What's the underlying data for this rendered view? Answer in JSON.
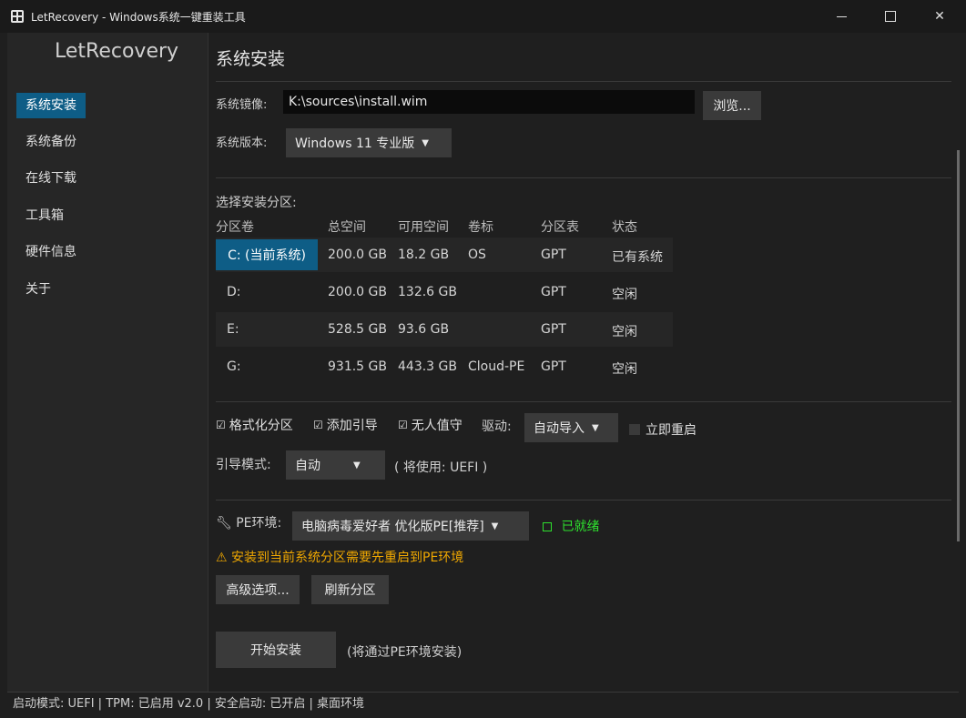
{
  "window": {
    "title": "LetRecovery - Windows系统一键重装工具",
    "minimize": "—",
    "maximize": "☐",
    "close": "✕"
  },
  "sidebar": {
    "brand": "LetRecovery",
    "items": [
      {
        "label": "系统安装",
        "active": true
      },
      {
        "label": "系统备份"
      },
      {
        "label": "在线下载"
      },
      {
        "label": "工具箱"
      },
      {
        "label": "硬件信息"
      },
      {
        "label": "关于"
      }
    ]
  },
  "main": {
    "title": "系统安装",
    "image_label": "系统镜像:",
    "image_path": "K:\\sources\\install.wim",
    "browse_label": "浏览...",
    "version_label": "系统版本:",
    "version_value": "Windows 11 专业版",
    "partition_title": "选择安装分区:",
    "table": {
      "headers": [
        "分区卷",
        "总空间",
        "可用空间",
        "卷标",
        "分区表",
        "状态"
      ],
      "rows": [
        {
          "volume": "C: (当前系统)",
          "total": "200.0 GB",
          "free": "18.2 GB",
          "label": "OS",
          "table": "GPT",
          "status": "已有系统",
          "selected": true
        },
        {
          "volume": "D:",
          "total": "200.0 GB",
          "free": "132.6 GB",
          "label": "",
          "table": "GPT",
          "status": "空闲"
        },
        {
          "volume": "E:",
          "total": "528.5 GB",
          "free": "93.6 GB",
          "label": "",
          "table": "GPT",
          "status": "空闲"
        },
        {
          "volume": "G:",
          "total": "931.5 GB",
          "free": "443.3 GB",
          "label": "Cloud-PE",
          "table": "GPT",
          "status": "空闲"
        }
      ]
    },
    "options": {
      "format": "格式化分区",
      "add_boot": "添加引导",
      "unattended": "无人值守",
      "driver_label": "驱动:",
      "driver_value": "自动导入",
      "reboot": "立即重启",
      "boot_mode_label": "引导模式:",
      "boot_mode_value": "自动",
      "boot_mode_hint": "( 将使用: UEFI )"
    },
    "pe": {
      "label": "PE环境:",
      "value": "电脑病毒爱好者 优化版PE[推荐]",
      "status": "已就绪",
      "warning": "⚠ 安装到当前系统分区需要先重启到PE环境"
    },
    "advanced_label": "高级选项...",
    "refresh_label": "刷新分区",
    "start_label": "开始安装",
    "start_hint": "(将通过PE环境安装)"
  },
  "statusbar": "启动模式: UEFI | TPM: 已启用 v2.0 | 安全启动: 已开启 | 桌面环境"
}
